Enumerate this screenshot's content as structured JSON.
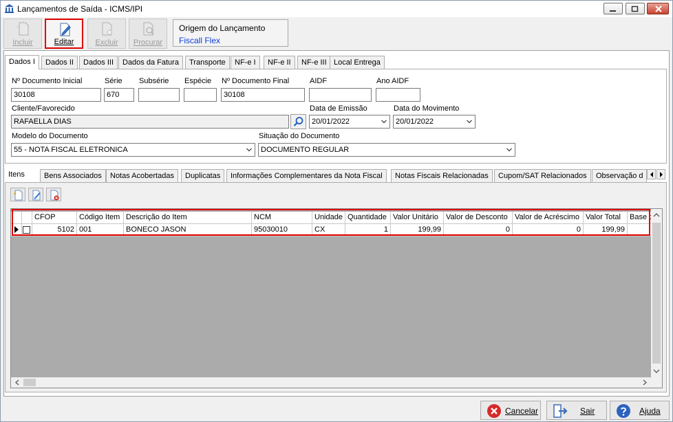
{
  "window": {
    "title": "Lançamentos de Saída - ICMS/IPI"
  },
  "toolbar": {
    "incluir": "Incluir",
    "editar": "Editar",
    "excluir": "Excluir",
    "procurar": "Procurar"
  },
  "origin": {
    "heading": "Origem do Lançamento",
    "value": "Fiscall Flex"
  },
  "tabs": [
    "Dados I",
    "Dados II",
    "Dados III",
    "Dados da Fatura",
    "Transporte",
    "NF-e I",
    "NF-e II",
    "NF-e III",
    "Local Entrega"
  ],
  "form": {
    "n_doc_inicial": {
      "label": "Nº Documento Inicial",
      "value": "30108"
    },
    "serie": {
      "label": "Série",
      "value": "670"
    },
    "subserie": {
      "label": "Subsérie",
      "value": ""
    },
    "especie": {
      "label": "Espécie",
      "value": ""
    },
    "n_doc_final": {
      "label": "Nº Documento Final",
      "value": "30108"
    },
    "aidf": {
      "label": "AIDF",
      "value": ""
    },
    "ano_aidf": {
      "label": "Ano AIDF",
      "value": ""
    },
    "cliente": {
      "label": "Cliente/Favorecido",
      "value": "RAFAELLA DIAS"
    },
    "data_emissao": {
      "label": "Data de Emissão",
      "value": "20/01/2022"
    },
    "data_movimento": {
      "label": "Data do Movimento",
      "value": "20/01/2022"
    },
    "modelo": {
      "label": "Modelo do Documento",
      "value": "55 - NOTA FISCAL ELETRONICA"
    },
    "situacao": {
      "label": "Situação do Documento",
      "value": "DOCUMENTO REGULAR"
    }
  },
  "tabs2": [
    "Itens",
    "Bens Associados",
    "Notas Acobertadas",
    "Duplicatas",
    "Informações Complementares da Nota Fiscal",
    "Notas Fiscais Relacionadas",
    "Cupom/SAT Relacionados",
    "Observação d"
  ],
  "grid": {
    "columns": [
      "CFOP",
      "Código Item",
      "Descrição do Item",
      "NCM",
      "Unidade",
      "Quantidade",
      "Valor Unitário",
      "Valor de Desconto",
      "Valor de Acréscimo",
      "Valor Total",
      "Base c"
    ],
    "rows": [
      {
        "cfop": "5102",
        "codigo": "001",
        "descricao": "BONECO JASON",
        "ncm": "95030010",
        "unidade": "CX",
        "quantidade": "1",
        "valor_unitario": "199,99",
        "desconto": "0",
        "acrescimo": "0",
        "total": "199,99",
        "base": ""
      }
    ]
  },
  "footer": {
    "cancelar": "Cancelar",
    "sair": "Sair",
    "ajuda": "Ajuda"
  }
}
